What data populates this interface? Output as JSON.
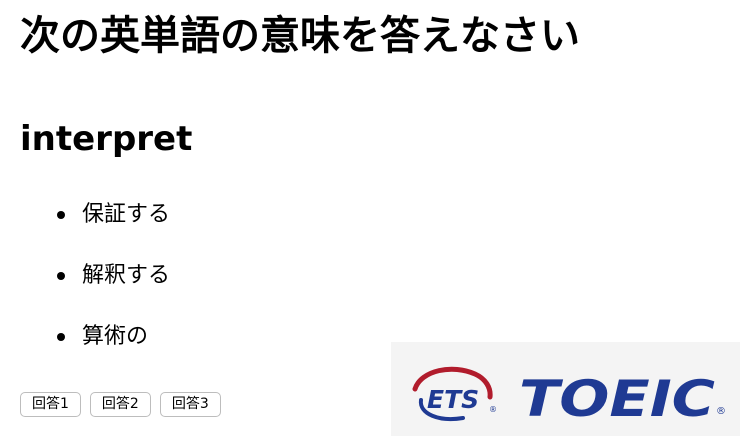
{
  "page": {
    "title": "次の英単語の意味を答えなさい"
  },
  "question": {
    "word": "interpret"
  },
  "choices": [
    {
      "label": "保証する"
    },
    {
      "label": "解釈する"
    },
    {
      "label": "算術の"
    }
  ],
  "buttons": [
    {
      "label": "回答1"
    },
    {
      "label": "回答2"
    },
    {
      "label": "回答3"
    }
  ],
  "logo": {
    "ets_text": "ETS",
    "brand_text": "TOEIC",
    "registered_mark": "®",
    "colors": {
      "blue": "#1f3a93",
      "red": "#b11c2c"
    }
  }
}
